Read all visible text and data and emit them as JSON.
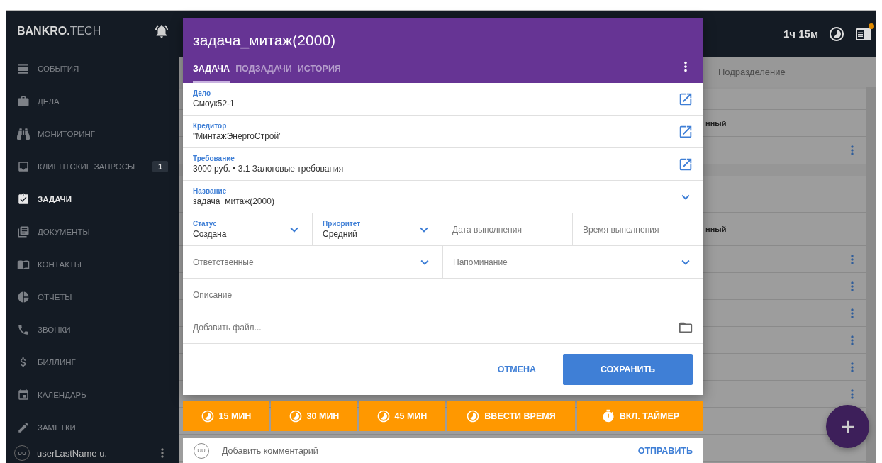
{
  "sidebar": {
    "logo_bold": "BANKRO.",
    "logo_light": "TECH",
    "items": [
      {
        "label": "СОБЫТИЯ",
        "selected": false
      },
      {
        "label": "ДЕЛА",
        "selected": false
      },
      {
        "label": "МОНИТОРИНГ",
        "selected": false
      },
      {
        "label": "КЛИЕНТСКИЕ ЗАПРОСЫ",
        "selected": false,
        "badge": "1"
      },
      {
        "label": "ЗАДАЧИ",
        "selected": true
      },
      {
        "label": "ДОКУМЕНТЫ",
        "selected": false
      },
      {
        "label": "КОНТАКТЫ",
        "selected": false
      },
      {
        "label": "ОТЧЕТЫ",
        "selected": false
      },
      {
        "label": "ЗВОНКИ",
        "selected": false
      },
      {
        "label": "БИЛЛИНГ",
        "selected": false
      },
      {
        "label": "КАЛЕНДАРЬ",
        "selected": false
      },
      {
        "label": "ЗАМЕТКИ",
        "selected": false
      }
    ],
    "user": {
      "initials": "UU",
      "name": "userLastName u."
    }
  },
  "topbar": {
    "timer": "1ч 15м"
  },
  "background": {
    "column_header": "Подразделение",
    "cut_texts": [
      "нный",
      "нный"
    ]
  },
  "modal": {
    "title": "задача_митаж(2000)",
    "tabs": [
      {
        "label": "ЗАДАЧА",
        "selected": true
      },
      {
        "label": "ПОДЗАДАЧИ",
        "selected": false
      },
      {
        "label": "ИСТОРИЯ",
        "selected": false
      }
    ],
    "link_fields": [
      {
        "label": "Дело",
        "value": "Смоук52-1"
      },
      {
        "label": "Кредитор",
        "value": "\"МинтажЭнергоСтрой\""
      },
      {
        "label": "Требование",
        "value": "3000 руб. • 3.1 Залоговые требования"
      }
    ],
    "name_field": {
      "label": "Название",
      "value": "задача_митаж(2000)"
    },
    "selects": [
      {
        "label": "Статус",
        "value": "Создана"
      },
      {
        "label": "Приоритет",
        "value": "Средний"
      }
    ],
    "date_placeholder": "Дата выполнения",
    "time_placeholder": "Время выполнения",
    "responsible_placeholder": "Ответственные",
    "reminder_placeholder": "Напоминание",
    "description_placeholder": "Описание",
    "file_placeholder": "Добавить файл...",
    "cancel": "ОТМЕНА",
    "save": "СОХРАНИТЬ"
  },
  "time_buttons": [
    {
      "label": "15 МИН",
      "kind": "clock"
    },
    {
      "label": "30 МИН",
      "kind": "clock"
    },
    {
      "label": "45 МИН",
      "kind": "clock"
    },
    {
      "label": "ВВЕСТИ ВРЕМЯ",
      "kind": "clock"
    },
    {
      "label": "ВКЛ. ТАЙМЕР",
      "kind": "stopwatch"
    }
  ],
  "comment": {
    "initials": "UU",
    "placeholder": "Добавить комментарий",
    "send": "ОТПРАВИТЬ"
  }
}
